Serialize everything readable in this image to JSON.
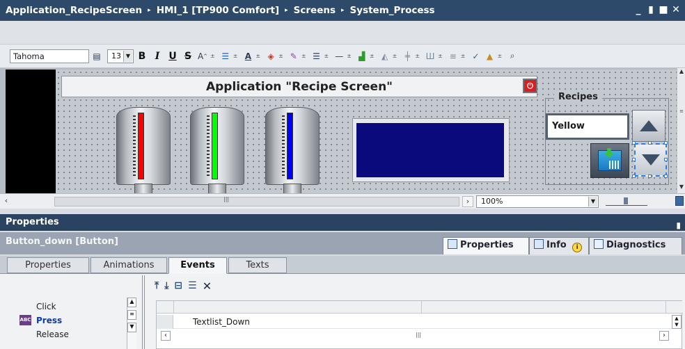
{
  "window": {
    "breadcrumb": [
      "Application_RecipeScreen",
      "HMI_1 [TP900 Comfort]",
      "Screens",
      "System_Process"
    ],
    "separator": "▸"
  },
  "toolbar": {
    "font_name": "Tahoma",
    "font_size": "13",
    "bold": "B",
    "italic": "I",
    "underline": "U",
    "strike": "S"
  },
  "canvas": {
    "title": "Application \"Recipe Screen\"",
    "tanks": [
      {
        "level_color": "#ff0000"
      },
      {
        "level_color": "#00ff00"
      },
      {
        "level_color": "#0000ff"
      }
    ],
    "display_color": "#0a0a7d",
    "recipes": {
      "legend": "Recipes",
      "selected": "Yellow"
    }
  },
  "editor_footer": {
    "zoom": "100%"
  },
  "properties_panel": {
    "title": "Properties",
    "selected_object": "Button_down [Button]",
    "right_tabs": [
      "Properties",
      "Info",
      "Diagnostics"
    ],
    "info_badge": "i",
    "sub_tabs": [
      "Properties",
      "Animations",
      "Events",
      "Texts"
    ],
    "active_sub_tab": "Events",
    "events": [
      "Click",
      "Press",
      "Release"
    ],
    "selected_event": "Press",
    "press_icon_text": "ABC",
    "function_rows": [
      "Textlist_Down"
    ]
  },
  "colors": {
    "title_bar": "#2d4a6b",
    "props_title": "#294361",
    "power_button": "#d81e1e"
  }
}
